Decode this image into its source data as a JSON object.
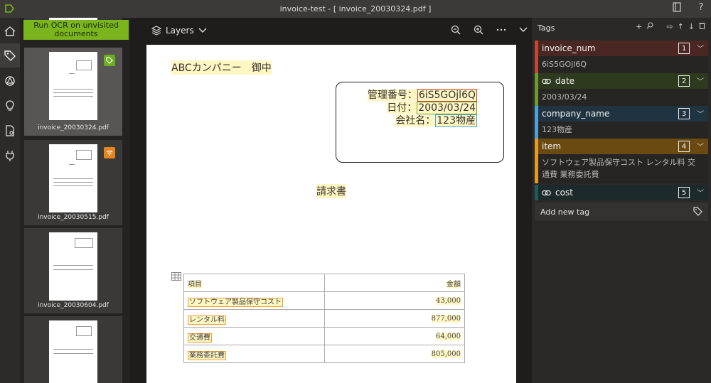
{
  "title_bar": {
    "title": "invoice-test - [ invoice_20030324.pdf ]"
  },
  "leftnav": {
    "items": [
      "home-icon",
      "tag-icon",
      "connection-icon",
      "lightbulb-icon",
      "settings-file-icon",
      "plug-icon"
    ],
    "active": "tag-icon"
  },
  "sidebar": {
    "ocr_button": "Run OCR on unvisited documents",
    "thumbnails": [
      {
        "label": "invoice_20030324.pdf",
        "active": true,
        "badge": "tag-icon",
        "badge_color": "#6ab01c"
      },
      {
        "label": "invoice_20030515.pdf",
        "active": false,
        "badge": "wifi-icon",
        "badge_color": "#e8851a"
      },
      {
        "label": "invoice_20030604.pdf",
        "active": false,
        "badge": null
      },
      {
        "label": "",
        "active": false,
        "badge": null
      }
    ]
  },
  "toolbar": {
    "layers_label": "Layers"
  },
  "document": {
    "recipient": "ABCカンパニー　御中",
    "fields": [
      {
        "label": "管理番号：",
        "value": "6iS5GOjl6Q"
      },
      {
        "label": "日付：",
        "value": "2003/03/24"
      },
      {
        "label": "会社名：",
        "value": "123物産"
      }
    ],
    "heading": "請求書",
    "table": {
      "headers": [
        "項目",
        "金額"
      ],
      "rows": [
        [
          "ソフトウェア製品保守コスト",
          "43,000"
        ],
        [
          "レンタル料",
          "877,000"
        ],
        [
          "交通費",
          "64,000"
        ],
        [
          "業務委託費",
          "805,000"
        ]
      ]
    }
  },
  "tags_panel": {
    "title": "Tags",
    "add_new": "Add new tag",
    "tags": [
      {
        "name": "invoice_num",
        "index": "1",
        "value": "6iS5GOjl6Q",
        "color": "#c8462f",
        "bg": "#4a2723",
        "linked": false
      },
      {
        "name": "date",
        "index": "2",
        "value": "2003/03/24",
        "color": "#6b9b2a",
        "bg": "#2d3a1e",
        "linked": true
      },
      {
        "name": "company_name",
        "index": "3",
        "value": "123物産",
        "color": "#4aa3d8",
        "bg": "#1f3340",
        "linked": false
      },
      {
        "name": "item",
        "index": "4",
        "value": "ソフトウェア製品保守コスト レンタル料 交通費 業務委託費",
        "color": "#e89a1a",
        "bg": "#6b4a12",
        "linked": false
      },
      {
        "name": "cost",
        "index": "5",
        "value": "",
        "color": "#1f5a5a",
        "bg": "#1c2a2b",
        "linked": true
      }
    ]
  }
}
